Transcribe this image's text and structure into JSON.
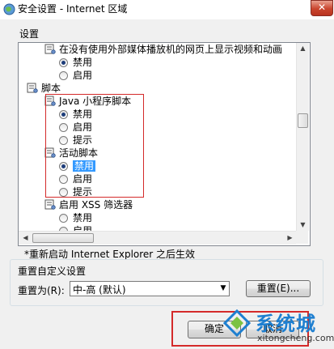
{
  "window": {
    "title": "安全设置 - Internet 区域",
    "close_label": "✕"
  },
  "settings_label": "设置",
  "list_items": [
    {
      "type": "setting",
      "text": "在没有使用外部媒体播放机的网页上显示视频和动画",
      "icon": "settings-icon",
      "indent": 1
    },
    {
      "type": "radio",
      "text": "禁用",
      "checked": true,
      "indent": 2
    },
    {
      "type": "radio",
      "text": "启用",
      "checked": false,
      "indent": 2
    },
    {
      "type": "category",
      "text": "脚本",
      "icon": "script-icon",
      "indent": 0
    },
    {
      "type": "setting",
      "text": "Java 小程序脚本",
      "icon": "settings-icon",
      "indent": 1
    },
    {
      "type": "radio",
      "text": "禁用",
      "checked": true,
      "indent": 2
    },
    {
      "type": "radio",
      "text": "启用",
      "checked": false,
      "indent": 2
    },
    {
      "type": "radio",
      "text": "提示",
      "checked": false,
      "indent": 2
    },
    {
      "type": "setting",
      "text": "活动脚本",
      "icon": "settings-icon",
      "indent": 1
    },
    {
      "type": "radio",
      "text": "禁用",
      "checked": true,
      "indent": 2,
      "selected": true
    },
    {
      "type": "radio",
      "text": "启用",
      "checked": false,
      "indent": 2
    },
    {
      "type": "radio",
      "text": "提示",
      "checked": false,
      "indent": 2
    },
    {
      "type": "setting",
      "text": "启用 XSS 筛选器",
      "icon": "settings-icon",
      "indent": 1
    },
    {
      "type": "radio",
      "text": "禁用",
      "checked": false,
      "indent": 2
    },
    {
      "type": "radio",
      "text": "启用",
      "checked": false,
      "indent": 2
    }
  ],
  "note": "*重新启动 Internet Explorer 之后生效",
  "reset_group": {
    "legend": "重置自定义设置",
    "reset_to_label": "重置为(R):",
    "reset_to_value": "中-高 (默认)",
    "reset_button": "重置(E)..."
  },
  "buttons": {
    "ok": "确定",
    "cancel": "取消"
  },
  "watermark": {
    "name": "系统城",
    "url": "xitongcheng.com"
  },
  "colors": {
    "highlight": "#d42a2a",
    "selection": "#3399ff",
    "watermark": "#1e7fd0"
  }
}
